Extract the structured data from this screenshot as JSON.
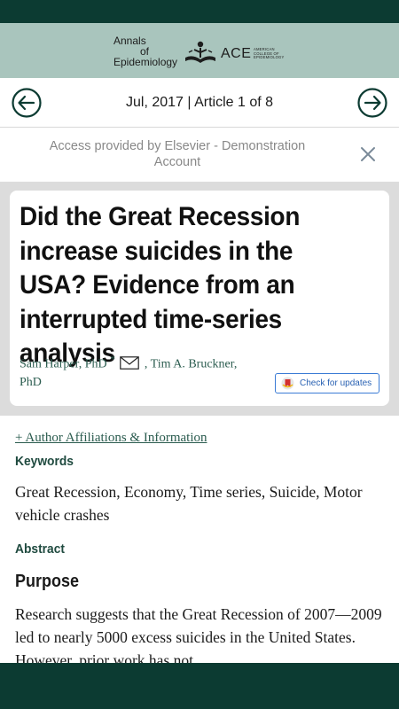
{
  "journal": {
    "name_line1": "Annals",
    "name_line2": "of",
    "name_line3": "Epidemiology",
    "ace_abbrev": "ACE",
    "ace_full": "AMERICAN COLLEGE OF EPIDEMIOLOGY"
  },
  "navigation": {
    "issue_info": "Jul, 2017 | Article 1 of 8"
  },
  "access_banner": {
    "text": "Access provided by Elsevier - Demonstration Account"
  },
  "article": {
    "title": "Did the Great Recession increase suicides in the USA? Evidence from an interrupted time-series analysis",
    "author1": "Sam Harper, PhD",
    "author1_marker": "*",
    "author2_part1": ", Tim A. Bruckner,",
    "author2_part2": "PhD",
    "check_updates_label": "Check for updates",
    "affiliations_link": "+ Author Affiliations & Information",
    "keywords_label": "Keywords",
    "keywords": "Great Recession, Economy, Time series, Suicide, Motor vehicle crashes",
    "abstract_label": "Abstract",
    "purpose_heading": "Purpose",
    "purpose_text": "Research suggests that the Great Recession of 2007—2009 led to nearly 5000 excess suicides in the United States. However, prior work has not"
  },
  "colors": {
    "status_bar": "#0c3b32",
    "header_bg": "#a9c5bd",
    "accent_green": "#2b5c4f",
    "link_blue": "#2a62b3"
  }
}
